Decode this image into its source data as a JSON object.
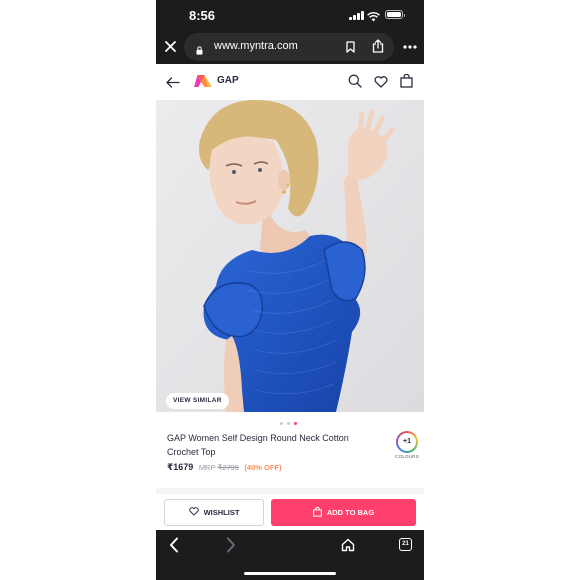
{
  "status_bar": {
    "time": "8:56",
    "icons": [
      "signal-icon",
      "wifi-icon",
      "battery-icon"
    ]
  },
  "browser": {
    "url": "www.myntra.com",
    "icons": [
      "close-icon",
      "lock-icon",
      "bookmark-icon",
      "share-icon",
      "more-icon"
    ],
    "bottom_icons": [
      "back-icon",
      "forward-icon",
      "home-icon",
      "tabs-icon"
    ],
    "tabs_count": "21"
  },
  "app_header": {
    "brand": "GAP",
    "icons": [
      "back-arrow-icon",
      "myntra-logo",
      "search-icon",
      "heart-icon",
      "bag-icon"
    ]
  },
  "product": {
    "view_similar": "VIEW SIMILAR",
    "carousel": {
      "count": 3,
      "active": 3
    },
    "title": "GAP Women Self Design Round Neck Cotton Crochet Top",
    "price": "₹1679",
    "mrp_label": "MRP",
    "mrp": "₹2799",
    "discount": "(40% OFF)",
    "colours_badge": "+1",
    "colours_label": "COLOURS"
  },
  "actions": {
    "wishlist": "WISHLIST",
    "add_to_bag": "ADD TO BAG"
  },
  "colors": {
    "accent": "#ff3f6c",
    "discount": "#ff905a",
    "browser_chrome": "#1c1c1e",
    "image_bg": "#e6e6e8",
    "top_blue": "#1f56c4"
  }
}
